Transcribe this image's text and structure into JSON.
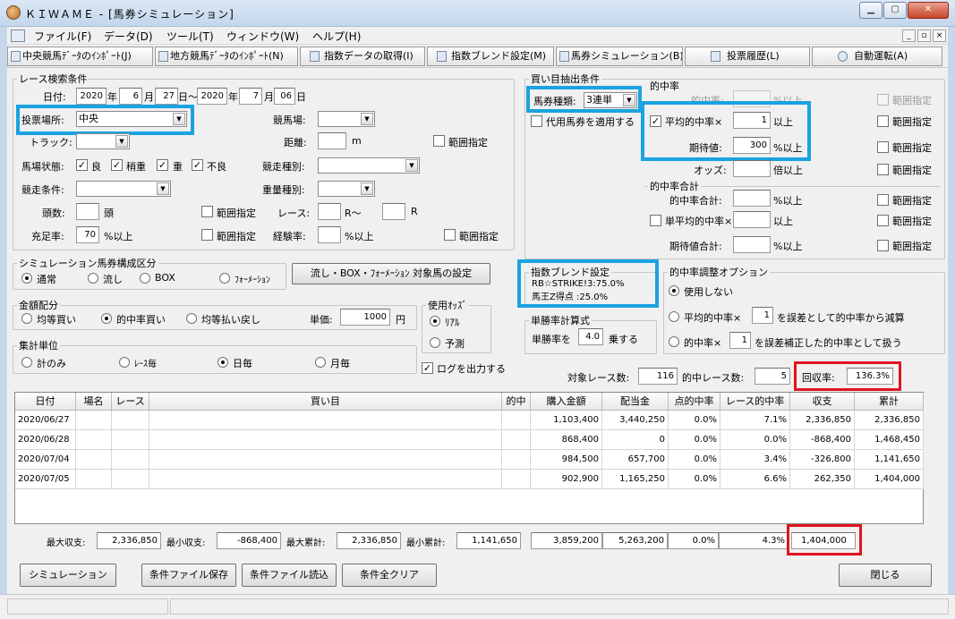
{
  "window": {
    "title": "ＫＩＷＡＭＥ - [馬券シミュレーション]"
  },
  "menu": [
    "ファイル(F)",
    "データ(D)",
    "ツール(T)",
    "ウィンドウ(W)",
    "ヘルプ(H)"
  ],
  "toolbar": {
    "import_central": "中央競馬ﾃﾞｰﾀのｲﾝﾎﾟｰﾄ(J)",
    "import_local": "地方競馬ﾃﾞｰﾀのｲﾝﾎﾟｰﾄ(N)",
    "get_index": "指数データの取得(I)",
    "index_blend": "指数ブレンド設定(M)",
    "betting_sim": "馬券シミュレーション(B)",
    "vote_history": "投票履歴(L)",
    "auto_run": "自動運転(A)"
  },
  "race_search": {
    "legend": "レース検索条件",
    "date_label": "日付:",
    "from_year": "2020",
    "year_unit": "年",
    "from_month": "6",
    "month_unit": "月",
    "from_day": "27",
    "day_tilde": "日～",
    "to_year": "2020",
    "to_month": "7",
    "to_day": "06",
    "day_unit": "日",
    "venue_label": "投票場所:",
    "venue_value": "中央",
    "course_label": "競馬場:",
    "course_value": "",
    "track_label": "トラック:",
    "track_value": "",
    "distance_label": "距離:",
    "distance_value": "",
    "distance_unit": "m",
    "range_label": "範囲指定",
    "condition_label": "馬場状態:",
    "cond_good": "良",
    "cond_slight": "稍重",
    "cond_heavy": "重",
    "cond_bad": "不良",
    "race_type_label": "競走種別:",
    "race_type_value": "",
    "race_cond_label": "競走条件:",
    "race_cond_value": "",
    "weight_type_label": "重量種別:",
    "weight_type_value": "",
    "heads_label": "頭数:",
    "heads_value": "",
    "heads_unit": "頭",
    "race_label": "レース:",
    "race_from": "",
    "race_from_unit": "R～",
    "race_to": "",
    "race_to_unit": "R",
    "fill_label": "充足率:",
    "fill_value": "70",
    "fill_unit": "%以上",
    "exp_label": "経験率:",
    "exp_value": "",
    "exp_unit": "%以上"
  },
  "buy_extract": {
    "legend": "買い目抽出条件",
    "bet_type_label": "馬券種類:",
    "bet_type_value": "3連単",
    "substitute_label": "代用馬券を適用する"
  },
  "hit_rate": {
    "legend": "的中率",
    "hit_label": "的中率:",
    "hit_unit": "%以上",
    "avg_label": "平均的中率×",
    "avg_value": "1",
    "avg_unit": "以上",
    "exp_label": "期待値:",
    "exp_value": "300",
    "exp_unit": "%以上",
    "odds_label": "オッズ:",
    "odds_unit": "倍以上",
    "range_label": "範囲指定"
  },
  "hit_total": {
    "legend": "的中率合計",
    "sum_label": "的中率合計:",
    "sum_unit": "%以上",
    "single_label": "単平均的中率×",
    "single_unit": "以上",
    "exp_sum_label": "期待値合計:",
    "exp_sum_unit": "%以上"
  },
  "sim_type": {
    "legend": "シミュレーション馬券構成区分",
    "normal": "通常",
    "nagashi": "流し",
    "box": "BOX",
    "formation": "ﾌｫｰﾒｰｼｮﾝ",
    "target_button": "流し・BOX・ﾌｫｰﾒｰｼｮﾝ 対象馬の設定"
  },
  "index_blend": {
    "legend": "指数ブレンド設定",
    "line1": "RB☆STRIKE!3:75.0%",
    "line2": "馬王Z得点 :25.0%"
  },
  "hit_adjust": {
    "legend": "的中率調整オプション",
    "none": "使用しない",
    "avg_prefix": "平均的中率×",
    "avg_value": "1",
    "avg_suffix": "を誤差として的中率から減算",
    "hit_prefix": "的中率×",
    "hit_value": "1",
    "hit_suffix": "を誤差補正した的中率として扱う"
  },
  "money": {
    "legend": "金額配分",
    "equal_buy": "均等買い",
    "hit_buy": "的中率買い",
    "equal_pay": "均等払い戻し",
    "unit_label": "単価:",
    "unit_value": "1000",
    "unit_suffix": "円"
  },
  "odds_use": {
    "legend": "使用ｵｯｽﾞ",
    "real": "ﾘｱﾙ",
    "forecast": "予測"
  },
  "win_rate": {
    "legend": "単勝率計算式",
    "prefix": "単勝率を",
    "value": "4.0",
    "suffix": "乗する"
  },
  "aggregate": {
    "legend": "集計単位",
    "total": "計のみ",
    "per_race": "ﾚｰｽ毎",
    "per_day": "日毎",
    "per_month": "月毎"
  },
  "log_output": "ログを出力する",
  "summary": {
    "race_count_label": "対象レース数:",
    "race_count": "116",
    "hit_count_label": "的中レース数:",
    "hit_count": "5",
    "recovery_label": "回収率:",
    "recovery": "136.3%"
  },
  "grid": {
    "headers": [
      "日付",
      "場名",
      "レース",
      "買い目",
      "的中",
      "購入金額",
      "配当金",
      "点的中率",
      "レース的中率",
      "収支",
      "累計"
    ],
    "rows": [
      [
        "2020/06/27",
        "",
        "",
        "",
        "",
        "1,103,400",
        "3,440,250",
        "0.0%",
        "7.1%",
        "2,336,850",
        "2,336,850"
      ],
      [
        "2020/06/28",
        "",
        "",
        "",
        "",
        "868,400",
        "0",
        "0.0%",
        "0.0%",
        "-868,400",
        "1,468,450"
      ],
      [
        "2020/07/04",
        "",
        "",
        "",
        "",
        "984,500",
        "657,700",
        "0.0%",
        "3.4%",
        "-326,800",
        "1,141,650"
      ],
      [
        "2020/07/05",
        "",
        "",
        "",
        "",
        "902,900",
        "1,165,250",
        "0.0%",
        "6.6%",
        "262,350",
        "1,404,000"
      ]
    ]
  },
  "totals": {
    "max_income_label": "最大収支:",
    "max_income": "2,336,850",
    "min_income_label": "最小収支:",
    "min_income": "-868,400",
    "max_cum_label": "最大累計:",
    "max_cum": "2,336,850",
    "min_cum_label": "最小累計:",
    "min_cum": "1,141,650",
    "purchase": "3,859,200",
    "payout": "5,263,200",
    "point_hit": "0.0%",
    "race_hit": "4.3%",
    "balance": "1,404,000"
  },
  "buttons": {
    "simulate": "シミュレーション",
    "save": "条件ファイル保存",
    "load": "条件ファイル読込",
    "clear": "条件全クリア",
    "close": "閉じる"
  },
  "highlight_colors": {
    "blue": "#1aa3e0",
    "red": "#e1141e"
  }
}
